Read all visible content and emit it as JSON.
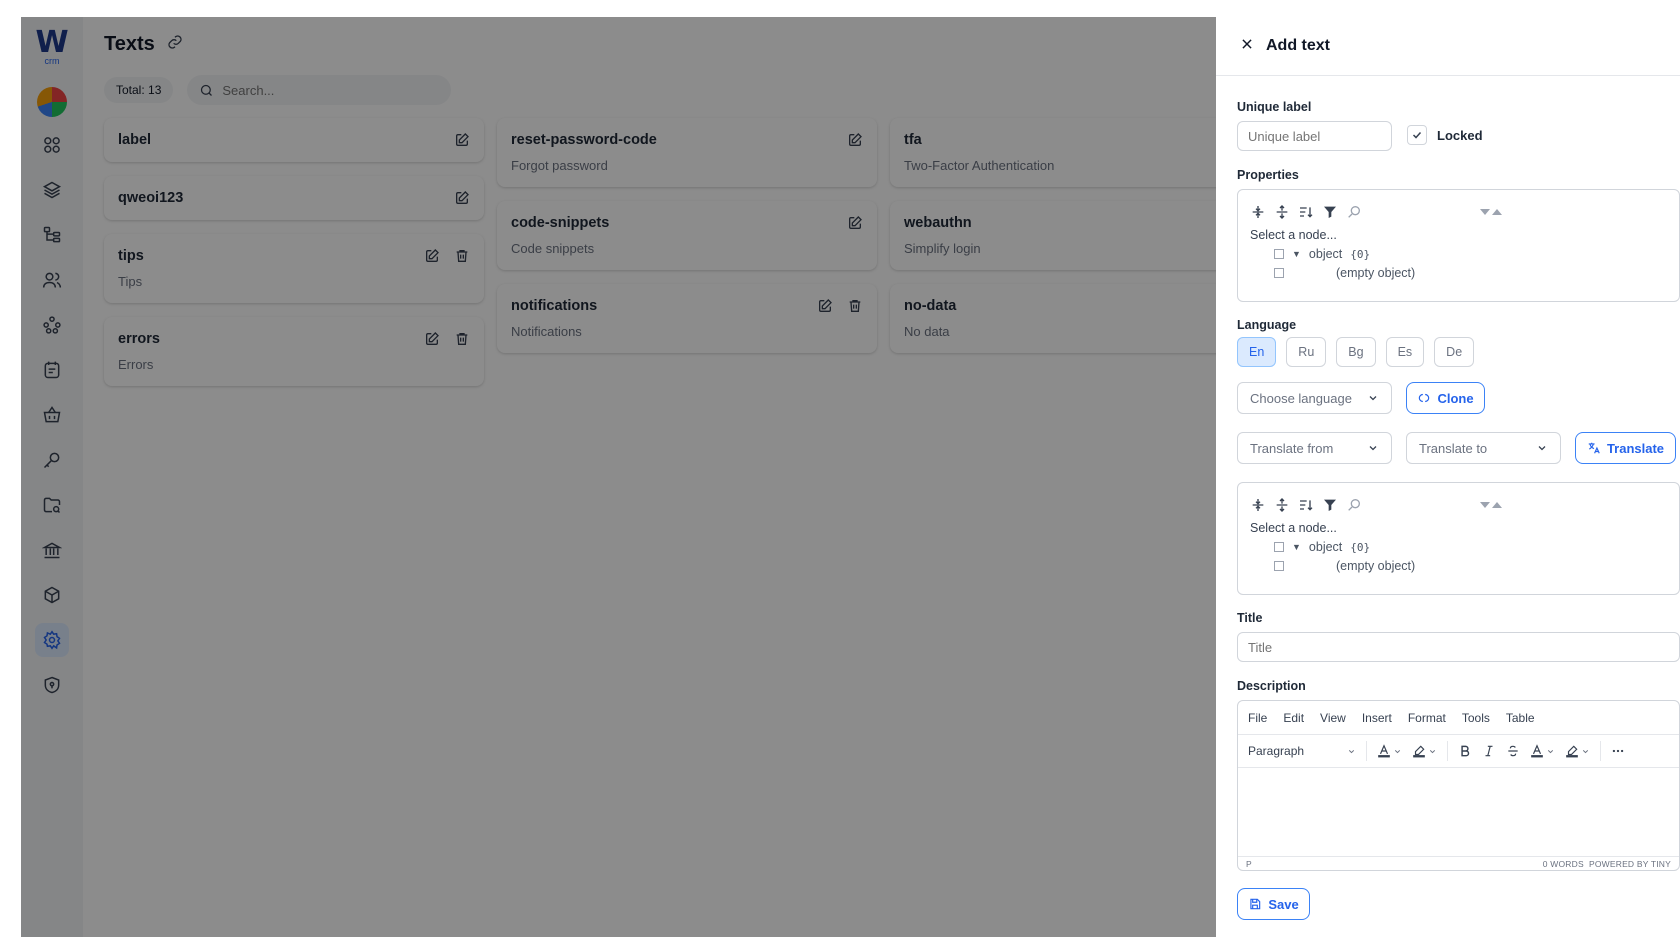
{
  "sidebar": {
    "logo_letter": "W",
    "logo_sub": "crm",
    "items": [
      {
        "icon": "grid-icon"
      },
      {
        "icon": "layers-icon"
      },
      {
        "icon": "hierarchy-icon"
      },
      {
        "icon": "users-icon"
      },
      {
        "icon": "network-icon"
      },
      {
        "icon": "notes-icon"
      },
      {
        "icon": "basket-icon"
      },
      {
        "icon": "key-icon"
      },
      {
        "icon": "folder-search-icon"
      },
      {
        "icon": "bank-icon"
      },
      {
        "icon": "box-icon"
      },
      {
        "icon": "gear-icon"
      },
      {
        "icon": "shield-icon"
      }
    ],
    "active_index": 11
  },
  "main": {
    "title": "Texts",
    "total": "Total: 13",
    "search_placeholder": "Search...",
    "columns": [
      [
        {
          "name": "label",
          "sub": "",
          "delete": false
        },
        {
          "name": "qweoi123",
          "sub": "",
          "delete": false
        },
        {
          "name": "tips",
          "sub": "Tips",
          "delete": true
        },
        {
          "name": "errors",
          "sub": "Errors",
          "delete": true
        }
      ],
      [
        {
          "name": "reset-password-code",
          "sub": "Forgot password",
          "delete": false
        },
        {
          "name": "code-snippets",
          "sub": "Code snippets",
          "delete": false
        },
        {
          "name": "notifications",
          "sub": "Notifications",
          "delete": true
        }
      ],
      [
        {
          "name": "tfa",
          "sub": "Two-Factor Authentication",
          "delete": false
        },
        {
          "name": "webauthn",
          "sub": "Simplify login",
          "delete": false
        },
        {
          "name": "no-data",
          "sub": "No data",
          "delete": false
        }
      ]
    ]
  },
  "drawer": {
    "title": "Add text",
    "unique_label": {
      "label": "Unique label",
      "placeholder": "Unique label"
    },
    "locked_label": "Locked",
    "properties_label": "Properties",
    "json": {
      "select_node": "Select a node...",
      "root": "object",
      "root_count": "{0}",
      "empty": "(empty object)"
    },
    "language_label": "Language",
    "languages": [
      "En",
      "Ru",
      "Bg",
      "Es",
      "De"
    ],
    "active_language": "En",
    "choose_language": "Choose language",
    "clone": "Clone",
    "translate_from": "Translate from",
    "translate_to": "Translate to",
    "translate": "Translate",
    "title_label": "Title",
    "title_placeholder": "Title",
    "description_label": "Description",
    "editor": {
      "menus": [
        "File",
        "Edit",
        "View",
        "Insert",
        "Format",
        "Tools",
        "Table"
      ],
      "block_format": "Paragraph",
      "status_left": "P",
      "status_words": "0 WORDS",
      "status_brand": "POWERED BY TINY"
    },
    "save": "Save"
  },
  "colors": {
    "accent": "#2563eb",
    "overlay": "rgba(0,0,0,0.45)"
  }
}
